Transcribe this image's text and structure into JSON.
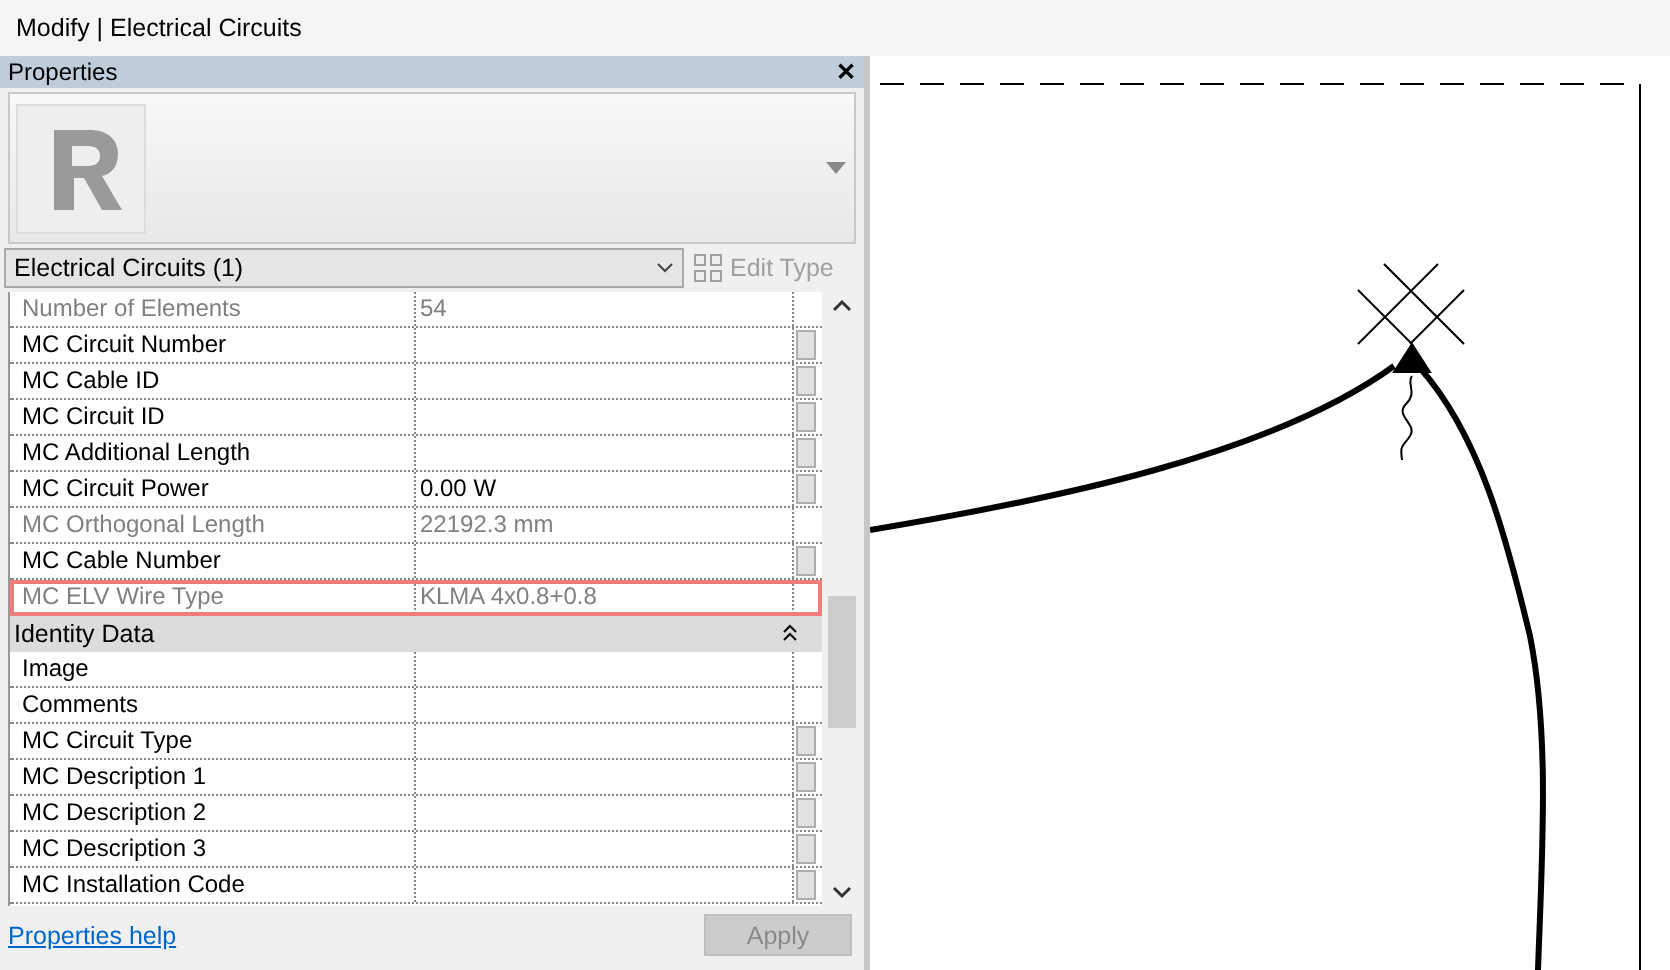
{
  "window": {
    "title": "Modify | Electrical Circuits"
  },
  "properties": {
    "title": "Properties",
    "close": "✕",
    "type_selector": {
      "value": "Electrical Circuits (1)"
    },
    "edit_type": {
      "label": "Edit Type",
      "disabled": true
    },
    "rows": [
      {
        "kind": "param",
        "label": "Number of Elements",
        "value": "54",
        "readonly": true,
        "has_button": false,
        "highlighted": false
      },
      {
        "kind": "param",
        "label": "MC Circuit Number",
        "readonly": false,
        "has_button": true,
        "highlighted": false
      },
      {
        "kind": "param",
        "label": "MC Cable ID",
        "readonly": false,
        "has_button": true,
        "highlighted": false
      },
      {
        "kind": "param",
        "label": "MC Circuit ID",
        "readonly": false,
        "has_button": true,
        "highlighted": false
      },
      {
        "kind": "param",
        "label": "MC Additional Length",
        "readonly": false,
        "has_button": true,
        "highlighted": false
      },
      {
        "kind": "param",
        "label": "MC Circuit Power",
        "value": "0.00 W",
        "readonly": false,
        "has_button": true,
        "highlighted": false
      },
      {
        "kind": "param",
        "label": "MC Orthogonal Length",
        "value": "22192.3 mm",
        "readonly": true,
        "has_button": false,
        "highlighted": false
      },
      {
        "kind": "param",
        "label": "MC Cable Number",
        "readonly": false,
        "has_button": true,
        "highlighted": false
      },
      {
        "kind": "param",
        "label": "MC ELV Wire Type",
        "value": "KLMA 4x0.8+0.8",
        "readonly": true,
        "has_button": false,
        "highlighted": true
      },
      {
        "kind": "group",
        "label": "Identity Data",
        "expanded": true
      },
      {
        "kind": "param",
        "label": "Image",
        "readonly": false,
        "has_button": false,
        "highlighted": false
      },
      {
        "kind": "param",
        "label": "Comments",
        "readonly": false,
        "has_button": false,
        "highlighted": false
      },
      {
        "kind": "param",
        "label": "MC Circuit Type",
        "readonly": false,
        "has_button": true,
        "highlighted": false
      },
      {
        "kind": "param",
        "label": "MC Description 1",
        "readonly": false,
        "has_button": true,
        "highlighted": false
      },
      {
        "kind": "param",
        "label": "MC Description 2",
        "readonly": false,
        "has_button": true,
        "highlighted": false
      },
      {
        "kind": "param",
        "label": "MC Description 3",
        "readonly": false,
        "has_button": true,
        "highlighted": false
      },
      {
        "kind": "param",
        "label": "MC Installation Code",
        "readonly": false,
        "has_button": true,
        "highlighted": false
      }
    ],
    "help_link": "Properties help",
    "apply": {
      "label": "Apply",
      "disabled": true
    }
  }
}
